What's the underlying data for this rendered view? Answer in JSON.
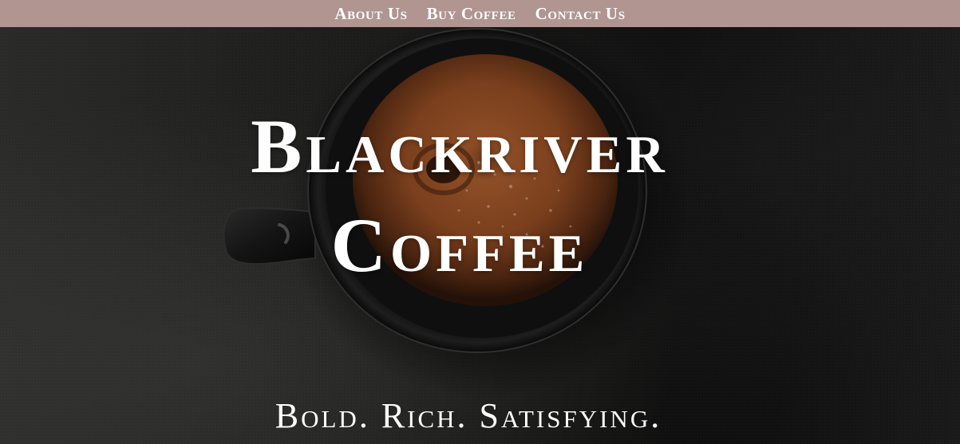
{
  "nav": {
    "items": [
      {
        "label": "About Us"
      },
      {
        "label": "Buy Coffee"
      },
      {
        "label": "Contact Us"
      }
    ]
  },
  "hero": {
    "title_line1": "Blackriver",
    "title_line2": "Coffee",
    "tagline": "Bold. Rich. Satisfying."
  },
  "colors": {
    "nav_background": "#b09591",
    "text": "#ffffff",
    "hero_background": "#151515",
    "coffee_crema": "#8a4a24"
  }
}
